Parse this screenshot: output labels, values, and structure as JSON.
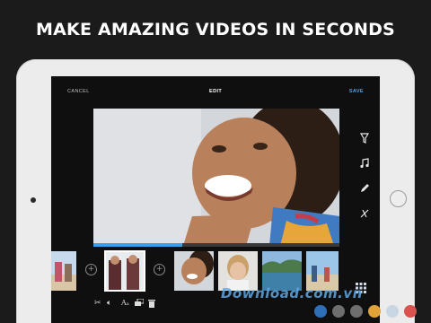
{
  "promo": {
    "headline": "MAKE AMAZING VIDEOS IN SECONDS"
  },
  "editor": {
    "topbar": {
      "cancel_label": "CANCEL",
      "title": "EDIT",
      "save_label": "SAVE"
    },
    "playback": {
      "progress_fraction": 0.36
    },
    "side_tools": [
      "filter-icon",
      "music-icon",
      "pencil-icon",
      "trim-icon"
    ],
    "timeline": {
      "clips": [
        "clip-beach-friends",
        "clip-two-women",
        "clip-woman-smiling",
        "clip-woman-laughing",
        "clip-coast",
        "clip-people-beach"
      ],
      "selected_clip_index": 1
    },
    "bottom_tools": [
      "scissors-icon",
      "volume-icon",
      "text-size-icon",
      "layers-icon",
      "trash-icon"
    ],
    "bottom_glyphs": {
      "text_size": "Aₐ"
    }
  },
  "watermark": "Download.com.vn",
  "colors": {
    "accent": "#4aa3e8",
    "progress": "#3f9fe6",
    "background": "#1b1b1b"
  }
}
